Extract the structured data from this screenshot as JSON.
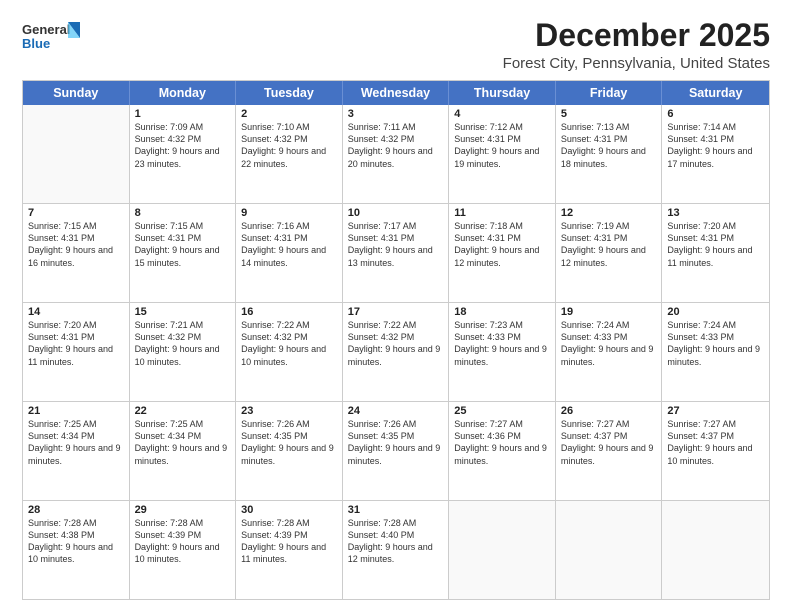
{
  "header": {
    "logo_general": "General",
    "logo_blue": "Blue",
    "month": "December 2025",
    "location": "Forest City, Pennsylvania, United States"
  },
  "days_of_week": [
    "Sunday",
    "Monday",
    "Tuesday",
    "Wednesday",
    "Thursday",
    "Friday",
    "Saturday"
  ],
  "weeks": [
    [
      {
        "day": "",
        "sunrise": "",
        "sunset": "",
        "daylight": ""
      },
      {
        "day": "1",
        "sunrise": "Sunrise: 7:09 AM",
        "sunset": "Sunset: 4:32 PM",
        "daylight": "Daylight: 9 hours and 23 minutes."
      },
      {
        "day": "2",
        "sunrise": "Sunrise: 7:10 AM",
        "sunset": "Sunset: 4:32 PM",
        "daylight": "Daylight: 9 hours and 22 minutes."
      },
      {
        "day": "3",
        "sunrise": "Sunrise: 7:11 AM",
        "sunset": "Sunset: 4:32 PM",
        "daylight": "Daylight: 9 hours and 20 minutes."
      },
      {
        "day": "4",
        "sunrise": "Sunrise: 7:12 AM",
        "sunset": "Sunset: 4:31 PM",
        "daylight": "Daylight: 9 hours and 19 minutes."
      },
      {
        "day": "5",
        "sunrise": "Sunrise: 7:13 AM",
        "sunset": "Sunset: 4:31 PM",
        "daylight": "Daylight: 9 hours and 18 minutes."
      },
      {
        "day": "6",
        "sunrise": "Sunrise: 7:14 AM",
        "sunset": "Sunset: 4:31 PM",
        "daylight": "Daylight: 9 hours and 17 minutes."
      }
    ],
    [
      {
        "day": "7",
        "sunrise": "Sunrise: 7:15 AM",
        "sunset": "Sunset: 4:31 PM",
        "daylight": "Daylight: 9 hours and 16 minutes."
      },
      {
        "day": "8",
        "sunrise": "Sunrise: 7:15 AM",
        "sunset": "Sunset: 4:31 PM",
        "daylight": "Daylight: 9 hours and 15 minutes."
      },
      {
        "day": "9",
        "sunrise": "Sunrise: 7:16 AM",
        "sunset": "Sunset: 4:31 PM",
        "daylight": "Daylight: 9 hours and 14 minutes."
      },
      {
        "day": "10",
        "sunrise": "Sunrise: 7:17 AM",
        "sunset": "Sunset: 4:31 PM",
        "daylight": "Daylight: 9 hours and 13 minutes."
      },
      {
        "day": "11",
        "sunrise": "Sunrise: 7:18 AM",
        "sunset": "Sunset: 4:31 PM",
        "daylight": "Daylight: 9 hours and 12 minutes."
      },
      {
        "day": "12",
        "sunrise": "Sunrise: 7:19 AM",
        "sunset": "Sunset: 4:31 PM",
        "daylight": "Daylight: 9 hours and 12 minutes."
      },
      {
        "day": "13",
        "sunrise": "Sunrise: 7:20 AM",
        "sunset": "Sunset: 4:31 PM",
        "daylight": "Daylight: 9 hours and 11 minutes."
      }
    ],
    [
      {
        "day": "14",
        "sunrise": "Sunrise: 7:20 AM",
        "sunset": "Sunset: 4:31 PM",
        "daylight": "Daylight: 9 hours and 11 minutes."
      },
      {
        "day": "15",
        "sunrise": "Sunrise: 7:21 AM",
        "sunset": "Sunset: 4:32 PM",
        "daylight": "Daylight: 9 hours and 10 minutes."
      },
      {
        "day": "16",
        "sunrise": "Sunrise: 7:22 AM",
        "sunset": "Sunset: 4:32 PM",
        "daylight": "Daylight: 9 hours and 10 minutes."
      },
      {
        "day": "17",
        "sunrise": "Sunrise: 7:22 AM",
        "sunset": "Sunset: 4:32 PM",
        "daylight": "Daylight: 9 hours and 9 minutes."
      },
      {
        "day": "18",
        "sunrise": "Sunrise: 7:23 AM",
        "sunset": "Sunset: 4:33 PM",
        "daylight": "Daylight: 9 hours and 9 minutes."
      },
      {
        "day": "19",
        "sunrise": "Sunrise: 7:24 AM",
        "sunset": "Sunset: 4:33 PM",
        "daylight": "Daylight: 9 hours and 9 minutes."
      },
      {
        "day": "20",
        "sunrise": "Sunrise: 7:24 AM",
        "sunset": "Sunset: 4:33 PM",
        "daylight": "Daylight: 9 hours and 9 minutes."
      }
    ],
    [
      {
        "day": "21",
        "sunrise": "Sunrise: 7:25 AM",
        "sunset": "Sunset: 4:34 PM",
        "daylight": "Daylight: 9 hours and 9 minutes."
      },
      {
        "day": "22",
        "sunrise": "Sunrise: 7:25 AM",
        "sunset": "Sunset: 4:34 PM",
        "daylight": "Daylight: 9 hours and 9 minutes."
      },
      {
        "day": "23",
        "sunrise": "Sunrise: 7:26 AM",
        "sunset": "Sunset: 4:35 PM",
        "daylight": "Daylight: 9 hours and 9 minutes."
      },
      {
        "day": "24",
        "sunrise": "Sunrise: 7:26 AM",
        "sunset": "Sunset: 4:35 PM",
        "daylight": "Daylight: 9 hours and 9 minutes."
      },
      {
        "day": "25",
        "sunrise": "Sunrise: 7:27 AM",
        "sunset": "Sunset: 4:36 PM",
        "daylight": "Daylight: 9 hours and 9 minutes."
      },
      {
        "day": "26",
        "sunrise": "Sunrise: 7:27 AM",
        "sunset": "Sunset: 4:37 PM",
        "daylight": "Daylight: 9 hours and 9 minutes."
      },
      {
        "day": "27",
        "sunrise": "Sunrise: 7:27 AM",
        "sunset": "Sunset: 4:37 PM",
        "daylight": "Daylight: 9 hours and 10 minutes."
      }
    ],
    [
      {
        "day": "28",
        "sunrise": "Sunrise: 7:28 AM",
        "sunset": "Sunset: 4:38 PM",
        "daylight": "Daylight: 9 hours and 10 minutes."
      },
      {
        "day": "29",
        "sunrise": "Sunrise: 7:28 AM",
        "sunset": "Sunset: 4:39 PM",
        "daylight": "Daylight: 9 hours and 10 minutes."
      },
      {
        "day": "30",
        "sunrise": "Sunrise: 7:28 AM",
        "sunset": "Sunset: 4:39 PM",
        "daylight": "Daylight: 9 hours and 11 minutes."
      },
      {
        "day": "31",
        "sunrise": "Sunrise: 7:28 AM",
        "sunset": "Sunset: 4:40 PM",
        "daylight": "Daylight: 9 hours and 12 minutes."
      },
      {
        "day": "",
        "sunrise": "",
        "sunset": "",
        "daylight": ""
      },
      {
        "day": "",
        "sunrise": "",
        "sunset": "",
        "daylight": ""
      },
      {
        "day": "",
        "sunrise": "",
        "sunset": "",
        "daylight": ""
      }
    ]
  ]
}
